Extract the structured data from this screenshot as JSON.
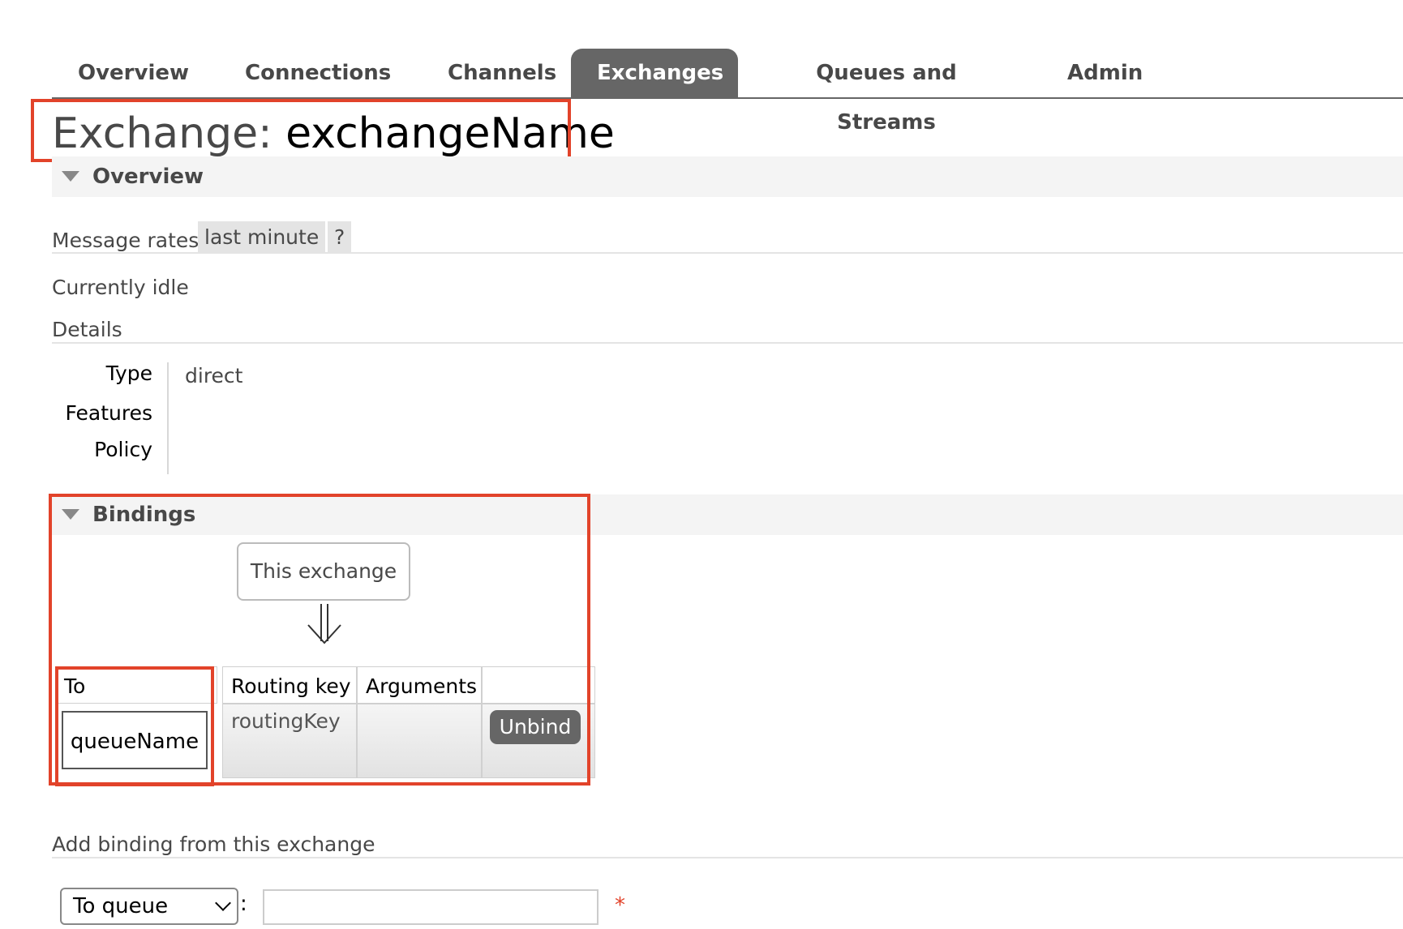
{
  "nav": {
    "tabs": [
      {
        "label": "Overview"
      },
      {
        "label": "Connections"
      },
      {
        "label": "Channels"
      },
      {
        "label": "Exchanges",
        "active": true
      },
      {
        "label": "Queues and Streams"
      },
      {
        "label": "Admin"
      }
    ]
  },
  "page": {
    "title_prefix": "Exchange:",
    "title_name": "exchangeName"
  },
  "overview": {
    "section_label": "Overview",
    "message_rates_label": "Message rates",
    "rate_period": "last minute",
    "help": "?",
    "status": "Currently idle",
    "details_label": "Details",
    "details": {
      "type_key": "Type",
      "type_value": "direct",
      "features_key": "Features",
      "policy_key": "Policy"
    }
  },
  "bindings": {
    "section_label": "Bindings",
    "source_node": "This exchange",
    "arrow": "down-double-arrow",
    "columns": [
      "To",
      "Routing key",
      "Arguments",
      ""
    ],
    "rows": [
      {
        "to": "queueName",
        "routing_key": "routingKey",
        "arguments": "",
        "action": "Unbind"
      }
    ]
  },
  "add_binding": {
    "label": "Add binding from this exchange",
    "destination_select": "To queue",
    "colon": ":",
    "destination_value": "",
    "required_mark": "*"
  },
  "colors": {
    "accent": "#e2432a",
    "tab_active_bg": "#666666",
    "section_bar_bg": "#f4f4f4"
  }
}
